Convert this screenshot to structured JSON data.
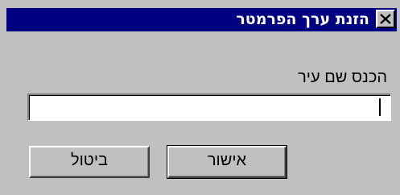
{
  "dialog": {
    "title": "הזנת ערך הפרמטר",
    "close_icon": "close-x-icon",
    "prompt": "הכנס שם עיר",
    "input": {
      "value": "",
      "placeholder": ""
    },
    "buttons": {
      "ok_label": "אישור",
      "cancel_label": "ביטול"
    }
  },
  "colors": {
    "titlebar": "#000080",
    "face": "#c0c0c0",
    "title_text": "#ffffff"
  }
}
